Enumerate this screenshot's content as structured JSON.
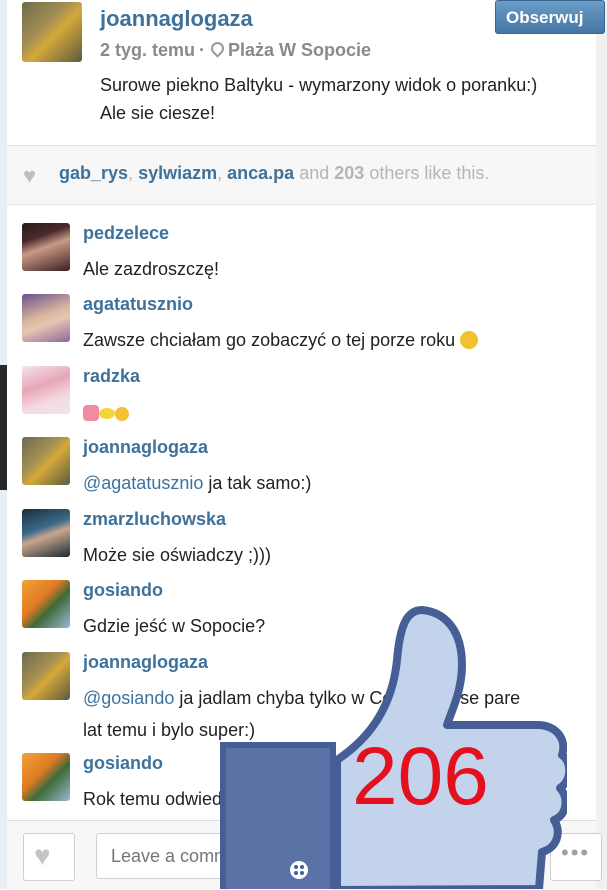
{
  "post": {
    "username": "joannaglogaza",
    "follow_label": "Obserwuj",
    "time": "2 tyg. temu",
    "location": "Plaża W Sopocie",
    "caption_line1": "Surowe piekno Baltyku - wymarzony widok o poranku:)",
    "caption_line2": "Ale sie ciesze!"
  },
  "likes": {
    "user1": "gab_rys",
    "user2": "sylwiazm",
    "user3": "anca.pa",
    "and": "and",
    "count": "203",
    "suffix": "others like this."
  },
  "comments": [
    {
      "user": "pedzelece",
      "text": "Ale zazdroszczę!"
    },
    {
      "user": "agatatusznio",
      "text": "Zawsze chciałam go zobaczyć o tej porze roku"
    },
    {
      "user": "radzka",
      "text": ""
    },
    {
      "user": "joannaglogaza",
      "mention": "@agatatusznio",
      "text": " ja tak samo:)"
    },
    {
      "user": "zmarzluchowska",
      "text": "Może sie oświadczy ;)))"
    },
    {
      "user": "gosiando",
      "text": "Gdzie jeść w Sopocie?"
    },
    {
      "user": "joannaglogaza",
      "mention": "@gosiando",
      "text": " ja jadlam chyba tylko w Coffee House pare",
      "text2": "lat temu i bylo super:)"
    },
    {
      "user": "gosiando",
      "text": "Rok temu odwiedziłam"
    }
  ],
  "input": {
    "placeholder": "Leave a comment..."
  },
  "overlay": {
    "like_count": "206"
  },
  "icons": {
    "heart": "heart-icon",
    "pin": "location-pin-icon",
    "more": "more-icon",
    "thumb": "thumbs-up-icon"
  },
  "colors": {
    "link": "#3f729b",
    "follow_button": "#4f7fad",
    "count": "#e5101e",
    "thumb": "#5b72a6"
  }
}
